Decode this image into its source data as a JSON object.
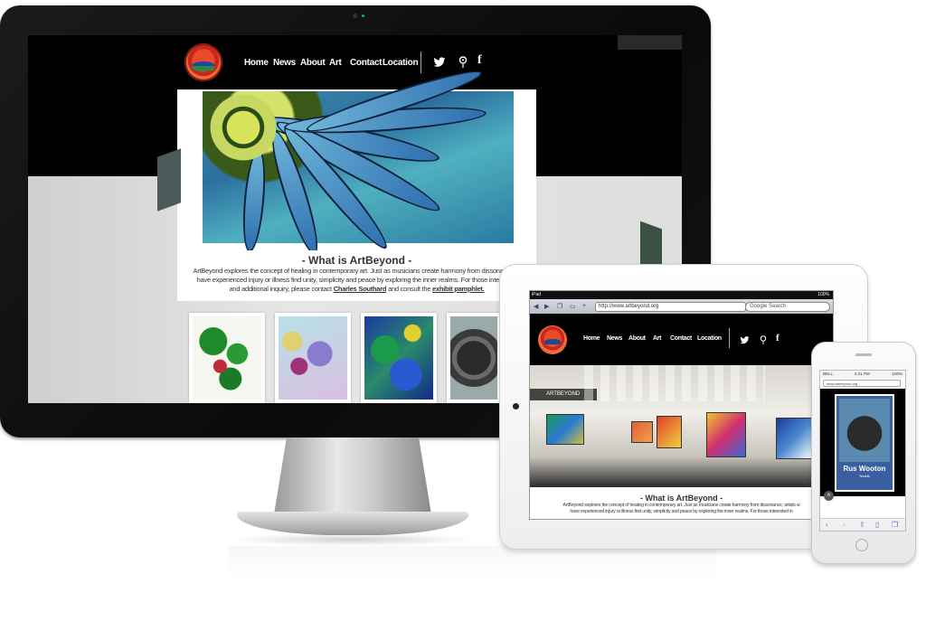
{
  "desktop": {
    "nav": [
      "Home",
      "News",
      "About",
      "Art",
      "Contact",
      "Location"
    ],
    "social": {
      "twitter": "twitter-icon",
      "pin": "map-pin-icon",
      "facebook": "f"
    },
    "section_title": "- What is ArtBeyond -",
    "paragraph": {
      "line1": "ArtBeyond explores the concept of healing in contemporary art. Just as musicians create harmony from dissonance, a",
      "line2": "have experienced injury or illness find unity, simplicity and peace by exploring the inner realms.  For those interested",
      "line3_pre": "and additional inquiry, please contact ",
      "contact_link": "Charles Southard",
      "line3_mid": " and consult the ",
      "pamphlet_link": "exhibit pamphlet.",
      "line3_post": ""
    }
  },
  "tablet": {
    "status_left": "iPad",
    "status_right": "100%",
    "url": "http://www.artbeyond.org",
    "search_placeholder": "Google Search",
    "nav": [
      "Home",
      "News",
      "About",
      "Art",
      "Contact",
      "Location"
    ],
    "banner": "ARTBEYOND",
    "section_title": "- What is ArtBeyond -",
    "para_line1": "ArtBeyond explores the concept of healing in contemporary art. Just as musicians create harmony from dissonance, artists w",
    "para_line2": "have experienced injury or illness find unity, simplicity and peace by exploring the inner realms.  For those interested in"
  },
  "phone": {
    "status_left": "BELL",
    "status_time": "4:21 PM",
    "status_right": "100%",
    "url": "www.artbeyond.org",
    "card_name": "Rus Wooton",
    "card_sub": "Tendrils"
  }
}
